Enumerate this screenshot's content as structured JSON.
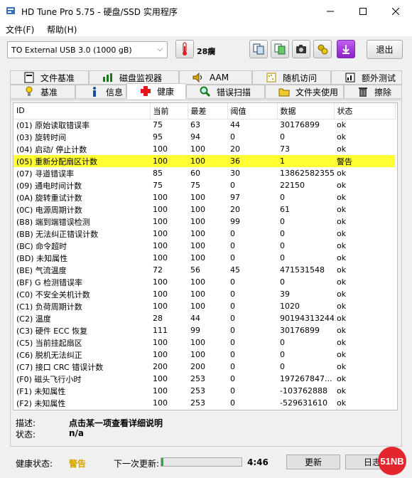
{
  "window": {
    "title": "HD Tune Pro 5.75 - 硬盘/SSD 实用程序"
  },
  "menu": {
    "file": "文件(F)",
    "help": "帮助(H)"
  },
  "toolbar": {
    "drive": "TO External USB 3.0 (1000 gB)",
    "temperature": "28瘸",
    "exit_label": "退出"
  },
  "tabs_top": [
    {
      "label": "文件基准",
      "icon": "file-benchmark-icon"
    },
    {
      "label": "磁盘监视器",
      "icon": "disk-monitor-icon"
    },
    {
      "label": "AAM",
      "icon": "speaker-icon"
    },
    {
      "label": "随机访问",
      "icon": "random-access-icon"
    },
    {
      "label": "额外测试",
      "icon": "extra-tests-icon"
    }
  ],
  "tabs_bottom": [
    {
      "label": "基准",
      "icon": "benchmark-icon"
    },
    {
      "label": "信息",
      "icon": "info-icon"
    },
    {
      "label": "健康",
      "icon": "health-cross-icon",
      "active": true
    },
    {
      "label": "错误扫描",
      "icon": "magnifier-icon"
    },
    {
      "label": "文件夹使用",
      "icon": "folder-icon"
    },
    {
      "label": "擦除",
      "icon": "trash-icon"
    }
  ],
  "table": {
    "headers": [
      "ID",
      "当前",
      "最差",
      "阈值",
      "数据",
      "状态"
    ],
    "rows": [
      [
        "(01) 原始读取错误率",
        "75",
        "63",
        "44",
        "30176899",
        "ok"
      ],
      [
        "(03) 旋转时间",
        "95",
        "94",
        "0",
        "0",
        "ok"
      ],
      [
        "(04) 启动/ 停止计数",
        "100",
        "100",
        "20",
        "73",
        "ok"
      ],
      [
        "(05) 重新分配扇区计数",
        "100",
        "100",
        "36",
        "1",
        "警告"
      ],
      [
        "(07) 寻道错误率",
        "85",
        "60",
        "30",
        "13862582355",
        "ok"
      ],
      [
        "(09) 通电时间计数",
        "75",
        "75",
        "0",
        "22150",
        "ok"
      ],
      [
        "(0A) 旋转重试计数",
        "100",
        "100",
        "97",
        "0",
        "ok"
      ],
      [
        "(0C) 电源周期计数",
        "100",
        "100",
        "20",
        "61",
        "ok"
      ],
      [
        "(B8) 端到端错误检测",
        "100",
        "100",
        "99",
        "0",
        "ok"
      ],
      [
        "(BB) 无法纠正错误计数",
        "100",
        "100",
        "0",
        "0",
        "ok"
      ],
      [
        "(BC) 命令超时",
        "100",
        "100",
        "0",
        "0",
        "ok"
      ],
      [
        "(BD) 未知属性",
        "100",
        "100",
        "0",
        "0",
        "ok"
      ],
      [
        "(BE) 气流温度",
        "72",
        "56",
        "45",
        "471531548",
        "ok"
      ],
      [
        "(BF) G 检测错误率",
        "100",
        "100",
        "0",
        "0",
        "ok"
      ],
      [
        "(C0) 不安全关机计数",
        "100",
        "100",
        "0",
        "39",
        "ok"
      ],
      [
        "(C1) 负荷周期计数",
        "100",
        "100",
        "0",
        "1020",
        "ok"
      ],
      [
        "(C2) 温度",
        "28",
        "44",
        "0",
        "90194313244",
        "ok"
      ],
      [
        "(C3) 硬件 ECC 恢复",
        "111",
        "99",
        "0",
        "30176899",
        "ok"
      ],
      [
        "(C5) 当前挂起扇区",
        "100",
        "100",
        "0",
        "0",
        "ok"
      ],
      [
        "(C6) 脱机无法纠正",
        "100",
        "100",
        "0",
        "0",
        "ok"
      ],
      [
        "(C7) 接口 CRC 错误计数",
        "200",
        "200",
        "0",
        "0",
        "ok"
      ],
      [
        "(F0) 磁头飞行小时",
        "100",
        "253",
        "0",
        "197267847...",
        "ok"
      ],
      [
        "(F1) 未知属性",
        "100",
        "253",
        "0",
        "-103762888",
        "ok"
      ],
      [
        "(F2) 未知属性",
        "100",
        "253",
        "0",
        "-529631610",
        "ok"
      ]
    ],
    "warn_row": 3,
    "warn_color": "#ffff33"
  },
  "details": {
    "desc_label": "描述:",
    "desc_value": "点击某一项查看详细说明",
    "status_label": "状态:",
    "status_value": "n/a"
  },
  "status": {
    "health_label": "健康状态:",
    "health_value": "警告",
    "next_update_label": "下一次更新:",
    "progress_fraction": 0.03,
    "countdown": "4:46",
    "update_button": "更新",
    "log_button": "日志",
    "watermark": "51NB"
  }
}
